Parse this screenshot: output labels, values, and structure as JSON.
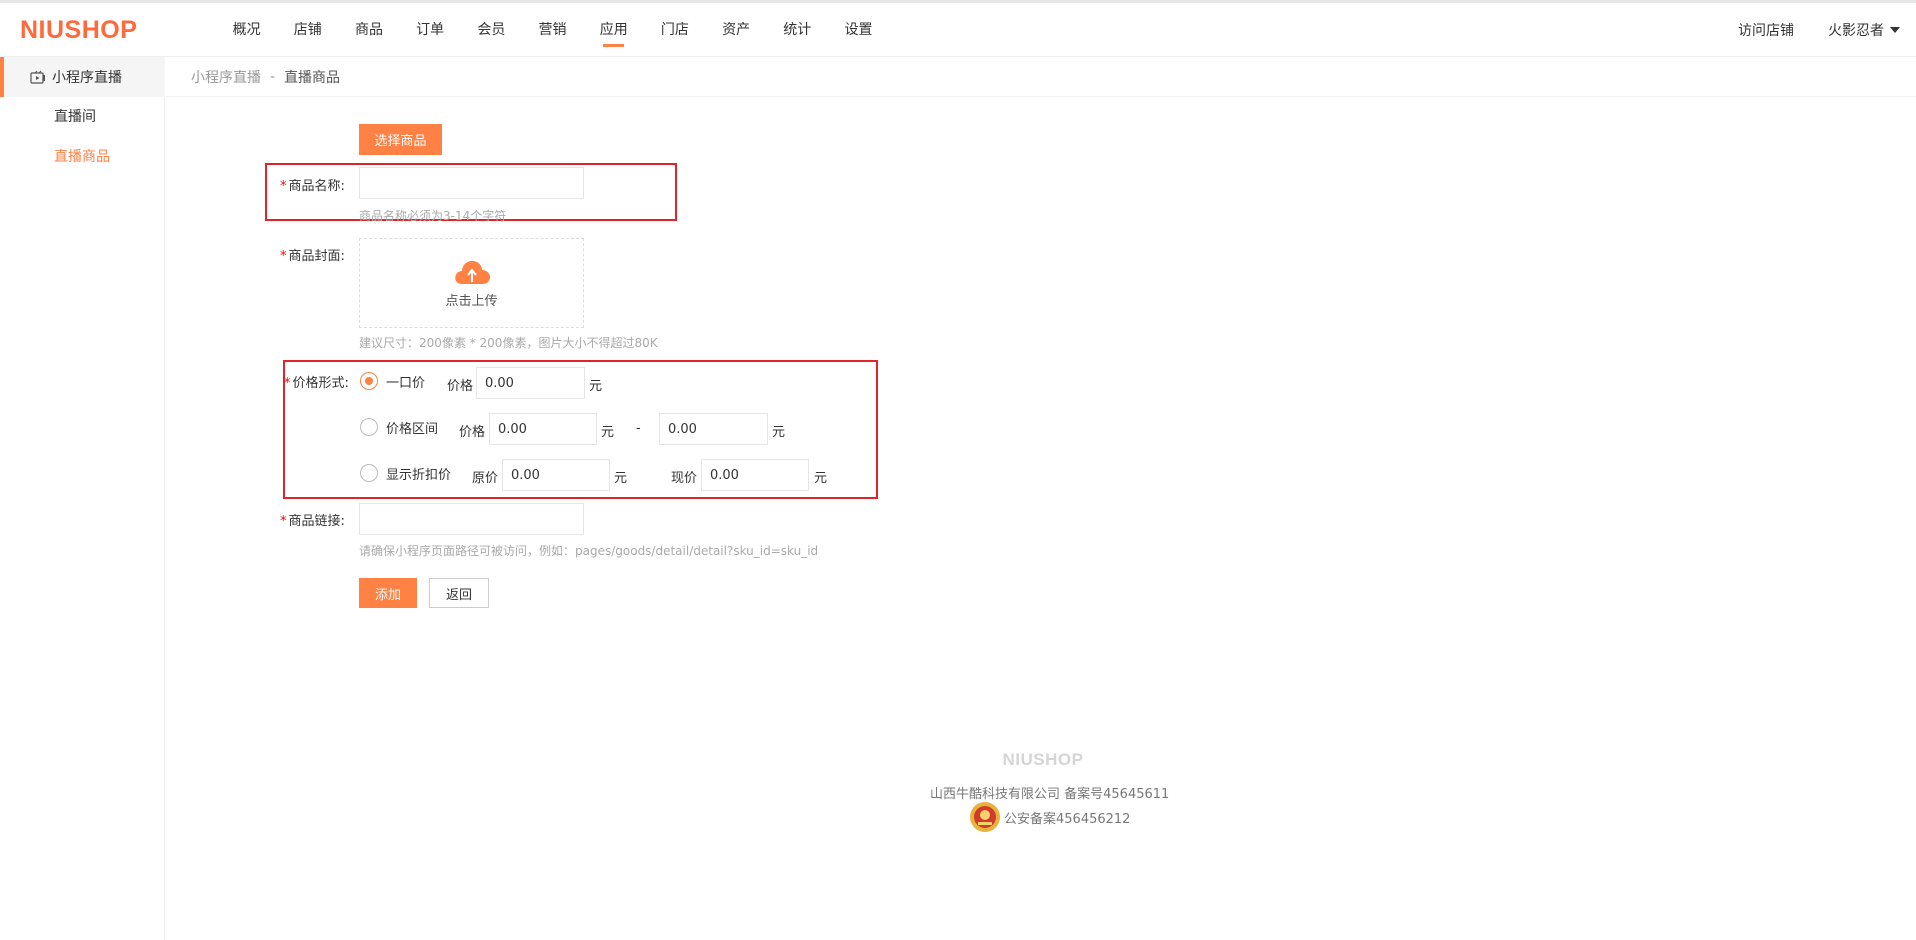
{
  "header": {
    "logo": "NIUSHOP",
    "nav": [
      "概况",
      "店铺",
      "商品",
      "订单",
      "会员",
      "营销",
      "应用",
      "门店",
      "资产",
      "统计",
      "设置"
    ],
    "active_nav": "应用",
    "visit_shop": "访问店铺",
    "user": "火影忍者"
  },
  "sidebar": {
    "title": "小程序直播",
    "items": [
      {
        "label": "直播间",
        "active": false
      },
      {
        "label": "直播商品",
        "active": true
      }
    ]
  },
  "breadcrumb": {
    "parent": "小程序直播",
    "separator": "-",
    "current": "直播商品"
  },
  "form": {
    "select_goods_button": "选择商品",
    "name": {
      "label": "商品名称:",
      "value": "",
      "hint": "商品名称必须为3-14个字符"
    },
    "cover": {
      "label": "商品封面:",
      "upload_text": "点击上传",
      "hint": "建议尺寸：200像素 * 200像素，图片大小不得超过80K"
    },
    "price_type": {
      "label": "价格形式:",
      "selected": "一口价",
      "options": [
        {
          "label": "一口价",
          "price_label": "价格",
          "price": "0.00",
          "unit": "元"
        },
        {
          "label": "价格区间",
          "price_label": "价格",
          "min": "0.00",
          "unit": "元",
          "separator": "-",
          "max": "0.00",
          "max_unit": "元"
        },
        {
          "label": "显示折扣价",
          "original_label": "原价",
          "original": "0.00",
          "unit": "元",
          "current_label": "现价",
          "current": "0.00",
          "current_unit": "元"
        }
      ]
    },
    "link": {
      "label": "商品链接:",
      "value": "",
      "hint": "请确保小程序页面路径可被访问，例如：pages/goods/detail/detail?sku_id=sku_id"
    },
    "add_button": "添加",
    "back_button": "返回"
  },
  "footer": {
    "logo": "NIUSHOP",
    "company": "山西牛酷科技有限公司  备案号45645611",
    "police": "公安备案456456212"
  },
  "colors": {
    "accent": "#ff8143",
    "highlight": "#e0242a"
  }
}
